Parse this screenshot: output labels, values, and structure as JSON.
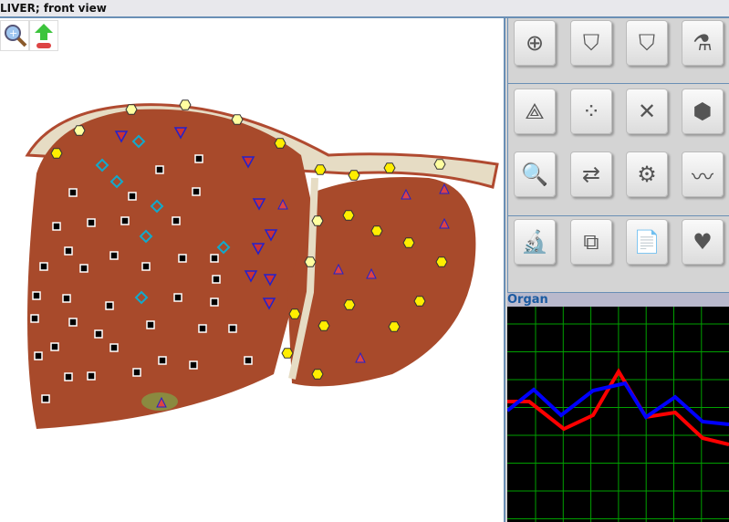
{
  "window": {
    "title": "LIVER; front  view"
  },
  "toolbar": {
    "zoom_icon": "magnifier-plus-icon",
    "export_icon": "green-up-arrow-icon"
  },
  "tools": [
    [
      {
        "name": "crosshair-tool",
        "glyph": "⊕"
      },
      {
        "name": "expand-tool",
        "glyph": "⛉"
      },
      {
        "name": "collapse-tool",
        "glyph": "⛉"
      },
      {
        "name": "organ-tool",
        "glyph": "⚗"
      }
    ],
    [
      {
        "name": "compass-tool",
        "glyph": "⟁"
      },
      {
        "name": "points-tool",
        "glyph": "⁘"
      },
      {
        "name": "delete-tool",
        "glyph": "✕"
      },
      {
        "name": "hexagons-tool",
        "glyph": "⬢"
      }
    ],
    [
      {
        "name": "analyze-graph-tool",
        "glyph": "🔍"
      },
      {
        "name": "compare-reports-tool",
        "glyph": "⇄"
      },
      {
        "name": "hierarchy-tool",
        "glyph": "⚙"
      },
      {
        "name": "spectrum-tool",
        "glyph": "〰"
      }
    ],
    [
      {
        "name": "microscope-tool",
        "glyph": "🔬"
      },
      {
        "name": "image-zoom-tool",
        "glyph": "⧉"
      },
      {
        "name": "documents-tool",
        "glyph": "📄"
      },
      {
        "name": "heart-tool",
        "glyph": "♥"
      }
    ]
  ],
  "organ_panel": {
    "label": "Organ",
    "colors": {
      "series1": "#0000ff",
      "series2": "#ff0000",
      "grid": "#00a000"
    }
  }
}
